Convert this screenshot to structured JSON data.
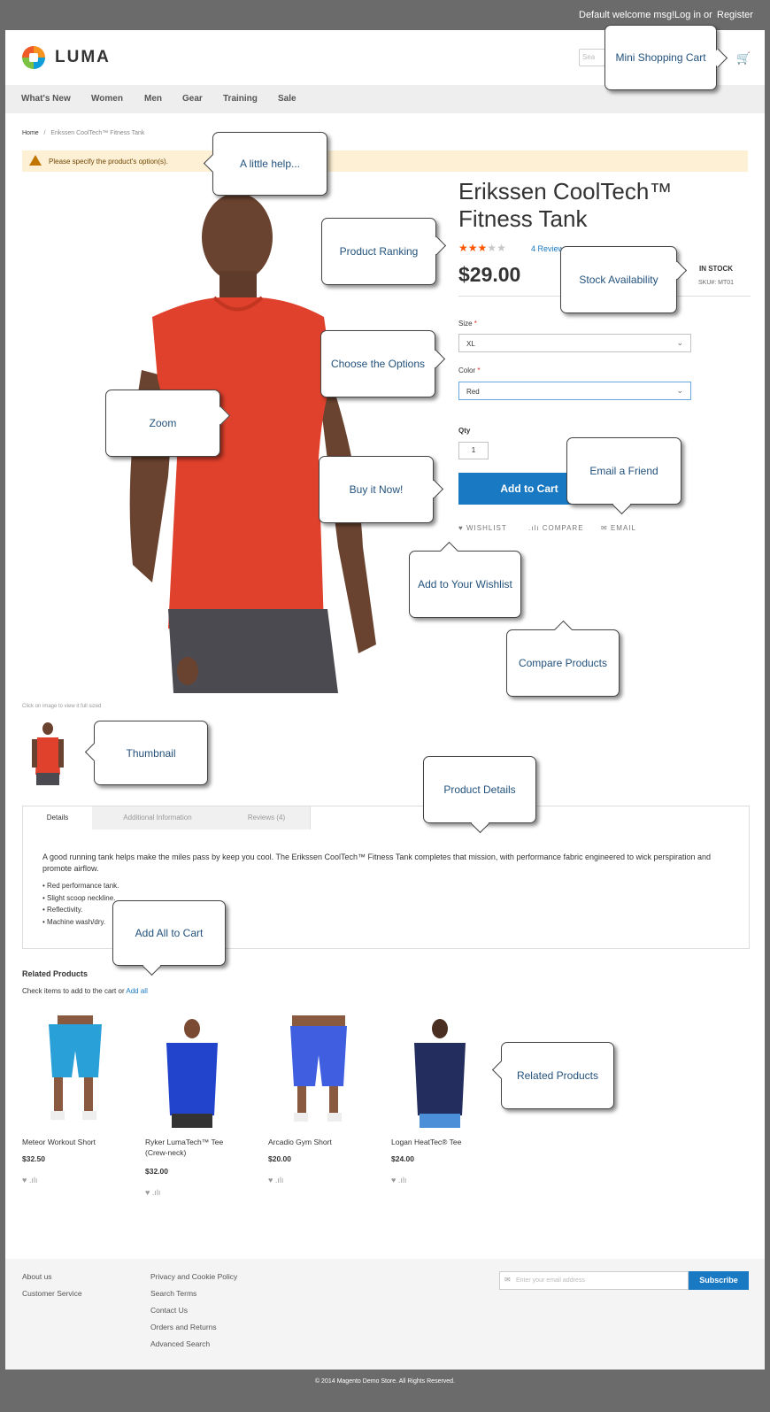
{
  "header": {
    "welcome": "Default welcome msg!",
    "login": "Log in",
    "or": "or",
    "register": "Register",
    "logo": "LUMA",
    "search_placeholder": "Sea"
  },
  "nav": [
    "What's New",
    "Women",
    "Men",
    "Gear",
    "Training",
    "Sale"
  ],
  "breadcrumb": {
    "home": "Home",
    "sep": "/",
    "current": "Erikssen CoolTech™ Fitness Tank"
  },
  "alert": "Please specify the product's option(s).",
  "product": {
    "title": "Erikssen CoolTech™ Fitness Tank",
    "rating_stars": 3,
    "rating_max": 5,
    "reviews": "4 Reviews",
    "price": "$29.00",
    "stock": "IN STOCK",
    "sku": "SKU#:  MT01",
    "size_label": "Size",
    "size_value": "XL",
    "color_label": "Color",
    "color_value": "Red",
    "required": "*",
    "qty_label": "Qty",
    "qty_value": "1",
    "add_to_cart": "Add to Cart",
    "wishlist": "WISHLIST",
    "compare": "COMPARE",
    "email": "EMAIL",
    "image_caption": "Click on image to view it full sized"
  },
  "tabs": [
    "Details",
    "Additional Information",
    "Reviews (4)"
  ],
  "details": {
    "description": "A good running tank helps make the miles pass by keep you cool. The Erikssen CoolTech™ Fitness Tank completes that mission, with performance fabric engineered to wick perspiration and promote airflow.",
    "bullets": [
      "• Red performance tank.",
      "• Slight scoop neckline.",
      "• Reflectivity.",
      "• Machine wash/dry."
    ]
  },
  "related": {
    "title": "Related Products",
    "sub": "Check items to add to the cart or",
    "add_all": "Add all",
    "items": [
      {
        "name": "Meteor Workout Short",
        "price": "$32.50"
      },
      {
        "name": "Ryker LumaTech™ Tee (Crew-neck)",
        "price": "$32.00"
      },
      {
        "name": "Arcadio Gym Short",
        "price": "$20.00"
      },
      {
        "name": "Logan HeatTec® Tee",
        "price": "$24.00"
      }
    ],
    "actions": "♥ .ılı"
  },
  "footer": {
    "col1": [
      "About us",
      "Customer Service"
    ],
    "col2": [
      "Privacy and Cookie Policy",
      "Search Terms",
      "Contact Us",
      "Orders and Returns",
      "Advanced Search"
    ],
    "newsletter_placeholder": "Enter your email address",
    "subscribe": "Subscribe",
    "copyright": "© 2014 Magento Demo Store. All Rights Reserved."
  },
  "callouts": {
    "mini_cart": "Mini Shopping Cart",
    "help": "A little help...",
    "ranking": "Product Ranking",
    "stock": "Stock Availability",
    "options": "Choose the Options",
    "zoom": "Zoom",
    "buy": "Buy it Now!",
    "email_friend": "Email a Friend",
    "wishlist": "Add to Your Wishlist",
    "compare": "Compare Products",
    "thumbnail": "Thumbnail",
    "details": "Product Details",
    "add_all": "Add All to Cart",
    "related": "Related Products"
  },
  "colors": {
    "accent": "#1979c3",
    "star": "#ff5501",
    "shirt": "#e0412c",
    "frame": "#6b6b6b"
  }
}
